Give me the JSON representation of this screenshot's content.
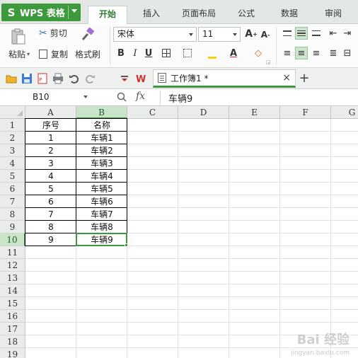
{
  "app": {
    "name": "WPS 表格",
    "logo": "S"
  },
  "tabs": [
    {
      "label": "开始",
      "active": true
    },
    {
      "label": "插入",
      "active": false
    },
    {
      "label": "页面布局",
      "active": false
    },
    {
      "label": "公式",
      "active": false
    },
    {
      "label": "数据",
      "active": false
    },
    {
      "label": "审阅",
      "active": false
    }
  ],
  "ribbon": {
    "paste_label": "粘贴",
    "cut_label": "剪切",
    "copy_label": "复制",
    "format_painter_label": "格式刷",
    "font_name": "宋体",
    "font_size": "11",
    "grow_font": "A",
    "shrink_font": "A",
    "bold": "B",
    "italic": "I",
    "underline": "U",
    "font_color_glyph": "A"
  },
  "quick_access": {
    "icons": [
      "open-folder-icon",
      "save-icon",
      "pdf-icon",
      "print-icon",
      "undo-icon",
      "redo-icon",
      "customize-icon",
      "wps-icon"
    ]
  },
  "document_tab": {
    "name": "工作簿1 *",
    "close": "×",
    "new_tab": "+"
  },
  "formula_bar": {
    "name_box": "B10",
    "fx": "fx",
    "value": "车辆9"
  },
  "sheet": {
    "columns": [
      "A",
      "B",
      "C",
      "D",
      "E",
      "F",
      "G"
    ],
    "selected_column": "B",
    "rows": [
      "1",
      "2",
      "3",
      "4",
      "5",
      "6",
      "7",
      "8",
      "9",
      "10",
      "11",
      "12",
      "13",
      "14",
      "15",
      "16",
      "17",
      "18",
      "19"
    ],
    "selected_row": "10",
    "active_cell": "B10",
    "data": [
      [
        "序号",
        "名称"
      ],
      [
        "1",
        "车辆1"
      ],
      [
        "2",
        "车辆2"
      ],
      [
        "3",
        "车辆3"
      ],
      [
        "4",
        "车辆4"
      ],
      [
        "5",
        "车辆5"
      ],
      [
        "6",
        "车辆6"
      ],
      [
        "7",
        "车辆7"
      ],
      [
        "8",
        "车辆8"
      ],
      [
        "9",
        "车辆9"
      ]
    ]
  },
  "colors": {
    "accent": "#3c9a3c",
    "selection_header": "#c9e4c9",
    "grid": "#dfe3e0"
  },
  "watermark": {
    "text": "Bai 经验",
    "sub": "jingyan.baidu.com"
  }
}
